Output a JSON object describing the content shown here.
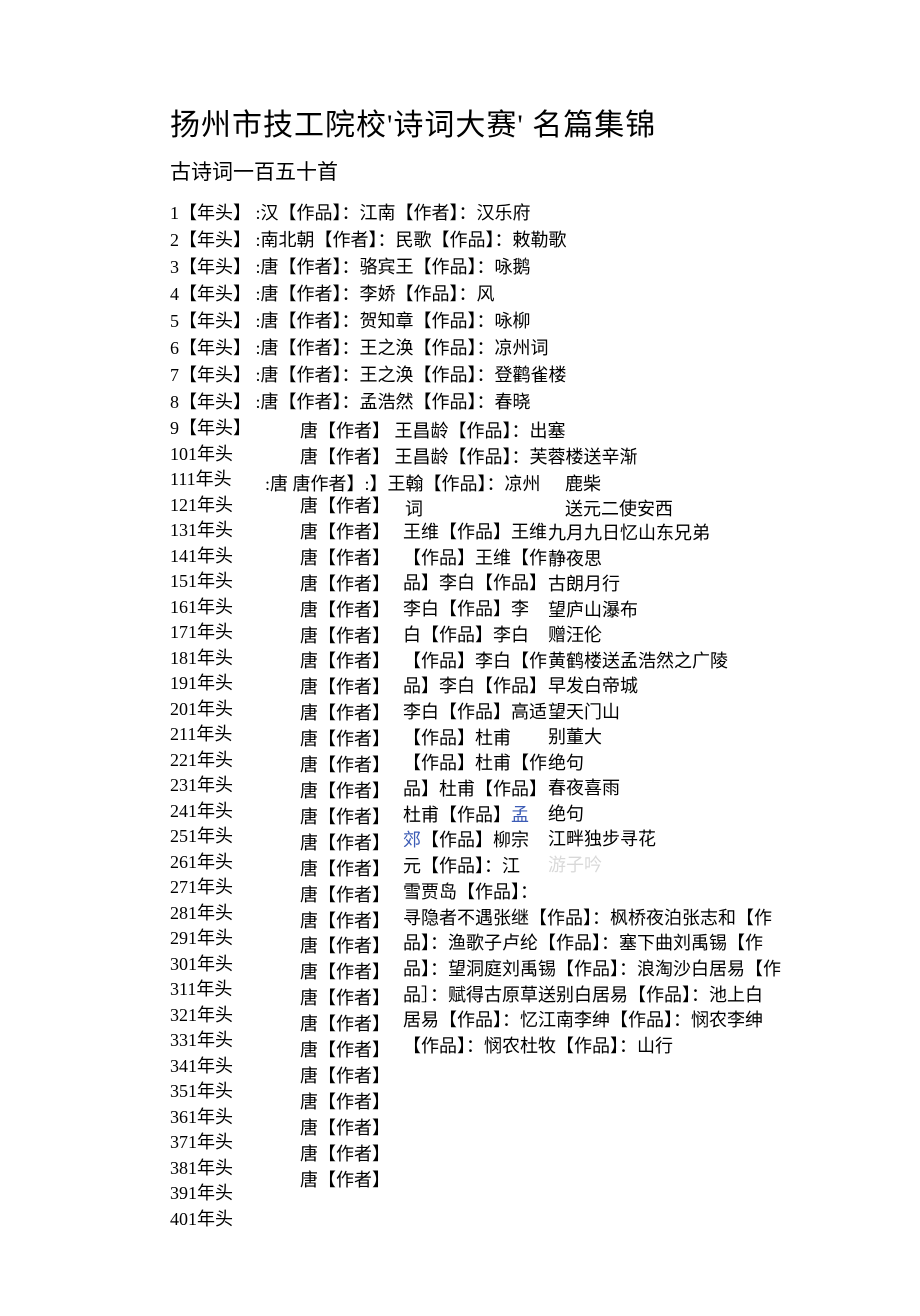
{
  "title": "扬州市技工院校'诗词大赛'  名篇集锦",
  "subtitle": "古诗词一百五十首",
  "simpleRows": [
    {
      "n": "1",
      "h": "【年头】",
      "d": ":汉【作品】：江南【作者】：汉乐府"
    },
    {
      "n": "2",
      "h": "【年头】",
      "d": ":南北朝【作者】：民歌【作品】：敕勒歌"
    },
    {
      "n": "3",
      "h": "【年头】",
      "d": ":唐【作者】：骆宾王【作品】：咏鹅"
    },
    {
      "n": "4",
      "h": "【年头】",
      "d": ":唐【作者】：李娇【作品】：风"
    },
    {
      "n": "5",
      "h": "【年头】",
      "d": ":唐【作者】：贺知章【作品】：咏柳"
    },
    {
      "n": "6",
      "h": "【年头】",
      "d": ":唐【作者】：王之涣【作品】：凉州词"
    },
    {
      "n": "7",
      "h": "【年头】",
      "d": ":唐【作者】：王之涣【作品】：登鹳雀楼"
    },
    {
      "n": "8",
      "h": "【年头】",
      "d": ":唐【作者】：孟浩然【作品】：春晓"
    }
  ],
  "leftCol": [
    "9【年头】",
    "101年头",
    "111年头",
    "121年头",
    "131年头",
    "141年头",
    "151年头",
    "161年头",
    "171年头",
    "181年头",
    "191年头",
    "201年头",
    "211年头",
    "221年头",
    "231年头",
    "241年头",
    "251年头",
    "261年头",
    "271年头",
    "281年头",
    "291年头",
    "301年头",
    "311年头",
    "321年头",
    "331年头",
    "341年头",
    "351年头",
    "361年头",
    "371年头",
    "381年头",
    "391年头",
    "401年头"
  ],
  "midCol": [
    "唐【作者】",
    "唐【作者】",
    "唐【作者】",
    "唐【作者】",
    "唐【作者】",
    "唐【作者】",
    "唐【作者】",
    "唐【作者】",
    "唐【作者】",
    "唐【作者】",
    "唐【作者】",
    "唐【作者】",
    "唐【作者】",
    "唐【作者】",
    "唐【作者】",
    "唐【作者】",
    "唐【作者】",
    "唐【作者】",
    "唐【作者】",
    "唐【作者】",
    "唐【作者】",
    "唐【作者】",
    "唐【作者】",
    "唐【作者】",
    "唐【作者】",
    "唐【作者】",
    "唐【作者】"
  ],
  "line9": "唐【作者】     王昌龄【作品】：出塞",
  "line10": "唐【作者】     王昌龄【作品】：芙蓉楼送辛渐",
  "line11": ":唐 唐作者】:】王翰【作品】：凉州",
  "ci": "词",
  "luchai": "鹿柴",
  "send": "送元二使安西",
  "authorCol": [
    "王维【作品】王维",
    "【作品】王维【作",
    "品】李白【作品】",
    "李白【作品】李",
    "白【作品】李白",
    "【作品】李白【作",
    "品】李白【作品】",
    "李白【作品】高适",
    "【作品】杜甫",
    "【作品】杜甫【作",
    "品】杜甫【作品】",
    "杜甫【作品】",
    "郊【作品】柳宗",
    "元【作品】：江",
    "雪贾岛【作品】：",
    "寻隐者不遇张继【作品】：枫桥夜泊张志和【作",
    "品】：渔歌子卢纶【作品】：塞下曲刘禹锡【作",
    "品】：望洞庭刘禹锡【作品】：浪淘沙白居易【作",
    "品］：赋得古原草送别白居易【作品】：池上白",
    "居易【作品】：忆江南李绅【作品】：悯农李绅",
    "【作品】：悯农杜牧【作品】：山行"
  ],
  "meng": "孟",
  "titleCol": [
    "九月九日忆山东兄弟",
    "静夜思",
    "古朗月行",
    "望庐山瀑布",
    "赠汪伦",
    "黄鹤楼送孟浩然之广陵",
    "早发白帝城",
    "望天门山",
    "别董大",
    "绝句",
    "春夜喜雨",
    "绝句",
    "江畔独步寻花",
    "游子吟"
  ]
}
